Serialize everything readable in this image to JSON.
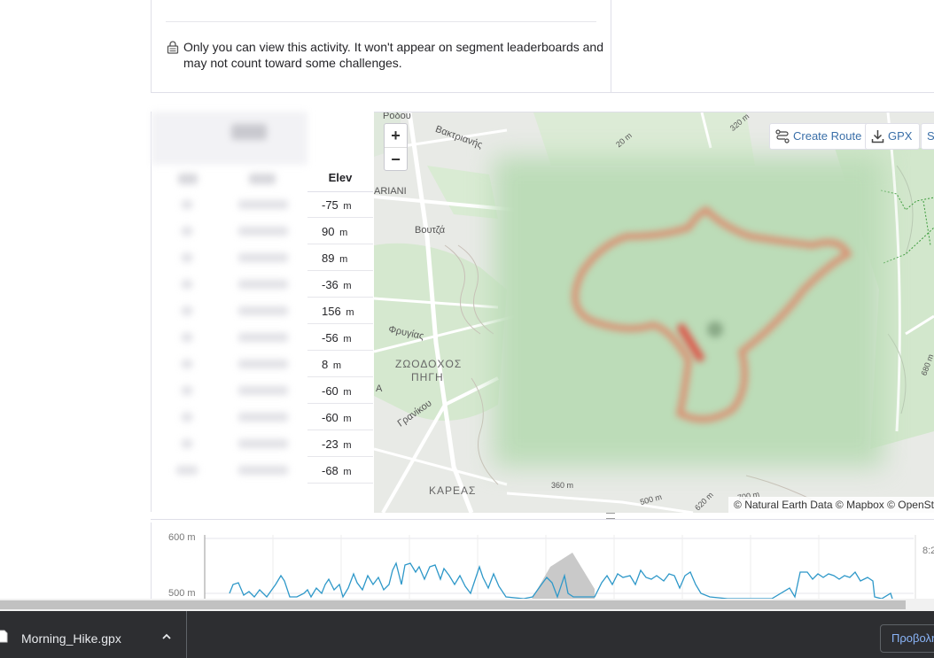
{
  "privacy": {
    "icon": "lock-icon",
    "message": "Only you can view this activity. It won't appear on segment leaderboards and may not count toward some challenges."
  },
  "splits": {
    "elev_header": "Elev",
    "elev_rows": [
      {
        "value": "-75",
        "unit": "m"
      },
      {
        "value": "90",
        "unit": "m"
      },
      {
        "value": "89",
        "unit": "m"
      },
      {
        "value": "-36",
        "unit": "m"
      },
      {
        "value": "156",
        "unit": "m"
      },
      {
        "value": "-56",
        "unit": "m"
      },
      {
        "value": "8",
        "unit": "m"
      },
      {
        "value": "-60",
        "unit": "m"
      },
      {
        "value": "-60",
        "unit": "m"
      },
      {
        "value": "-23",
        "unit": "m"
      },
      {
        "value": "-68",
        "unit": "m"
      }
    ]
  },
  "map": {
    "zoom_in": "+",
    "zoom_out": "−",
    "create_route": "Create Route",
    "gpx": "GPX",
    "third_button": "S",
    "attribution": "© Natural Earth Data © Mapbox © OpenSt",
    "labels": {
      "bactriana": "Βακτριανής",
      "voutza": "Βουτζά",
      "frygias": "Φρυγίας",
      "zoodochos": "ΖΩΟΔΟΧΟΣ",
      "pigi": "ΠΗΓΗ",
      "granikou": "Γρανίκου",
      "kareas": "ΚΑΡΕΑΣ",
      "ariani": "ARIANI",
      "a": "A",
      "rodou": "Ρόδου",
      "c320": "320 m",
      "c360": "360 m",
      "c500": "500 m",
      "c620": "620 m",
      "c700": "700 m",
      "c680": "680 m",
      "c20": "20 m"
    }
  },
  "elevation_chart": {
    "y_labels": [
      "600 m",
      "500 m"
    ],
    "right_label": "8:2"
  },
  "downloads": {
    "file_name": "Morning_Hike.gpx",
    "show_all": "Προβολή"
  }
}
